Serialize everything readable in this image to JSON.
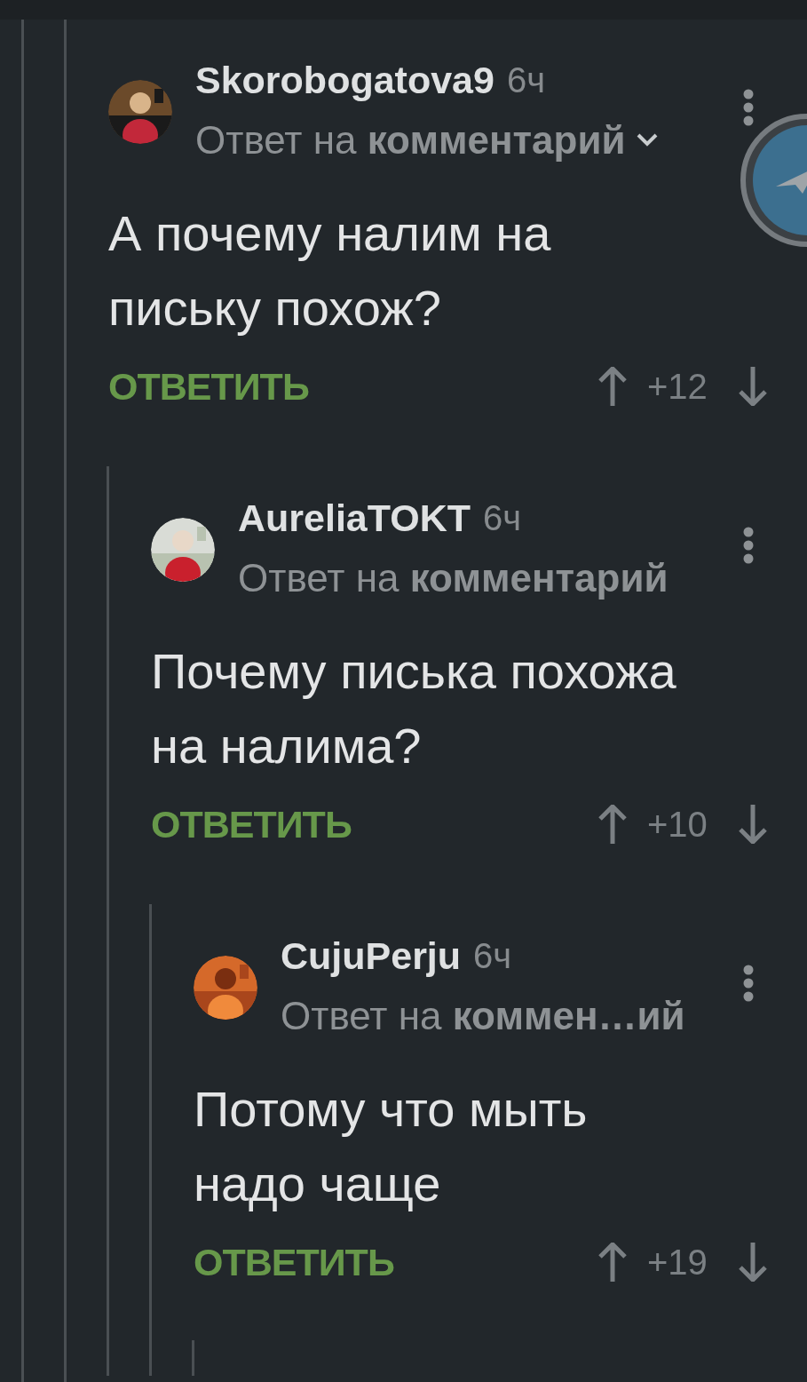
{
  "comments": [
    {
      "author": "Skorobogatova9",
      "time": "6ч",
      "reply_to": "Ответ на **комментарий**",
      "collapsible": true,
      "text": "А почему налим на\nпиську похож?",
      "reply_button": "ОТВЕТИТЬ",
      "rating": "+12",
      "children": [
        {
          "author": "AureliaTOKT",
          "time": "6ч",
          "reply_to": "Ответ на **комментарий**",
          "collapsible": false,
          "text": "Почему писька похожа\nна налима?",
          "reply_button": "ОТВЕТИТЬ",
          "rating": "+10",
          "children": [
            {
              "author": "CujuPerju",
              "time": "6ч",
              "reply_to": "Ответ на **коммен…ий**",
              "collapsible": false,
              "text": "Потому что мыть\nнадо чаще",
              "reply_button": "ОТВЕТИТЬ",
              "rating": "+19"
            }
          ]
        }
      ]
    }
  ]
}
